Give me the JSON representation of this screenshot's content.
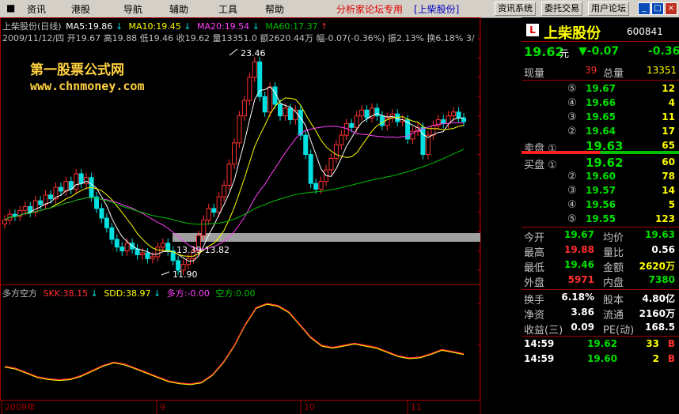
{
  "menu": {
    "items": [
      "资讯",
      "港股",
      "导航",
      "辅助",
      "工具",
      "帮助"
    ],
    "promo": "分析家论坛专用",
    "promo_stock": "[上柴股份]",
    "buttons": [
      "资讯系统",
      "委托交易",
      "用户论坛"
    ],
    "window_buttons": [
      "_",
      "□",
      "×"
    ]
  },
  "chart_header": {
    "title": "上柴股份(日线)",
    "ma5": "MA5:19.86",
    "ma10": "MA10:19.45",
    "ma20": "MA20:19.54",
    "ma60": "MA60:17.37",
    "quote_line": "2009/11/12/四 开19.67 高19.88 低19.46 收19.62 量13351.0 额2620.44万 幅-0.07(-0.36%) 振2.13% 换6.18% 3/"
  },
  "watermark": {
    "line1": "第一股票公式网",
    "line2": "www.chnmoney.com"
  },
  "annotations": {
    "high": "23.46",
    "low": "11.90",
    "band": "13.39-13.82"
  },
  "price_axis": [
    "24.00",
    "23.00",
    "22.00",
    "21.00",
    "20.00",
    "19.00",
    "18.00",
    "17.00",
    "16.00",
    "15.00",
    "14.00",
    "13.00",
    "12.00"
  ],
  "indicator": {
    "name": "多方空方",
    "skk": "SKK:38.15",
    "sdd": "SDD:38.97",
    "duofang": "多方:-0.00",
    "kongfang": "空方:0.00",
    "axis": [
      "200.0",
      "100.0"
    ]
  },
  "date_axis": [
    "2009年",
    "9",
    "10",
    "11"
  ],
  "colors": {
    "up": "#ff3030",
    "down": "#00e0e0",
    "ma5": "#ffffff",
    "ma10": "#ffff00",
    "ma20": "#ff40ff",
    "ma60": "#00c000"
  },
  "stock": {
    "logo": "L",
    "name": "上柴股份",
    "code": "600841",
    "price": "19.62",
    "price_unit": "元",
    "change": "▼-0.07",
    "change2": "-0.36",
    "xianliang_label": "现量",
    "xianliang": "39",
    "zongliang_label": "总量",
    "zongliang": "13351"
  },
  "sell_book": [
    {
      "label": "⑤",
      "price": "19.67",
      "vol": "12"
    },
    {
      "label": "④",
      "price": "19.66",
      "vol": "4"
    },
    {
      "label": "③",
      "price": "19.65",
      "vol": "11"
    },
    {
      "label": "②",
      "price": "19.64",
      "vol": "17"
    },
    {
      "label": "卖盘 ①",
      "price": "19.63",
      "vol": "65"
    }
  ],
  "buy_book": [
    {
      "label": "买盘 ①",
      "price": "19.62",
      "vol": "60"
    },
    {
      "label": "②",
      "price": "19.60",
      "vol": "78"
    },
    {
      "label": "③",
      "price": "19.57",
      "vol": "14"
    },
    {
      "label": "④",
      "price": "19.56",
      "vol": "5"
    },
    {
      "label": "⑤",
      "price": "19.55",
      "vol": "123"
    }
  ],
  "stats": [
    {
      "l1": "今开",
      "v1": "19.67",
      "l2": "均价",
      "v2": "19.63"
    },
    {
      "l1": "最高",
      "v1": "19.88",
      "l2": "量比",
      "v2": "0.56"
    },
    {
      "l1": "最低",
      "v1": "19.46",
      "l2": "金额",
      "v2": "2620万"
    },
    {
      "l1": "外盘",
      "v1": "5971",
      "l2": "内盘",
      "v2": "7380"
    }
  ],
  "stats2": [
    {
      "l1": "换手",
      "v1": "6.18%",
      "l2": "股本",
      "v2": "4.80亿"
    },
    {
      "l1": "净资",
      "v1": "3.86",
      "l2": "流通",
      "v2": "2160万"
    },
    {
      "l1": "收益(三)",
      "v1": "0.09",
      "l2": "PE(动)",
      "v2": "168.5"
    }
  ],
  "ticks": [
    {
      "time": "14:59",
      "price": "19.62",
      "vol": "33",
      "side": "B"
    },
    {
      "time": "14:59",
      "price": "19.60",
      "vol": "2",
      "side": "B"
    }
  ]
}
